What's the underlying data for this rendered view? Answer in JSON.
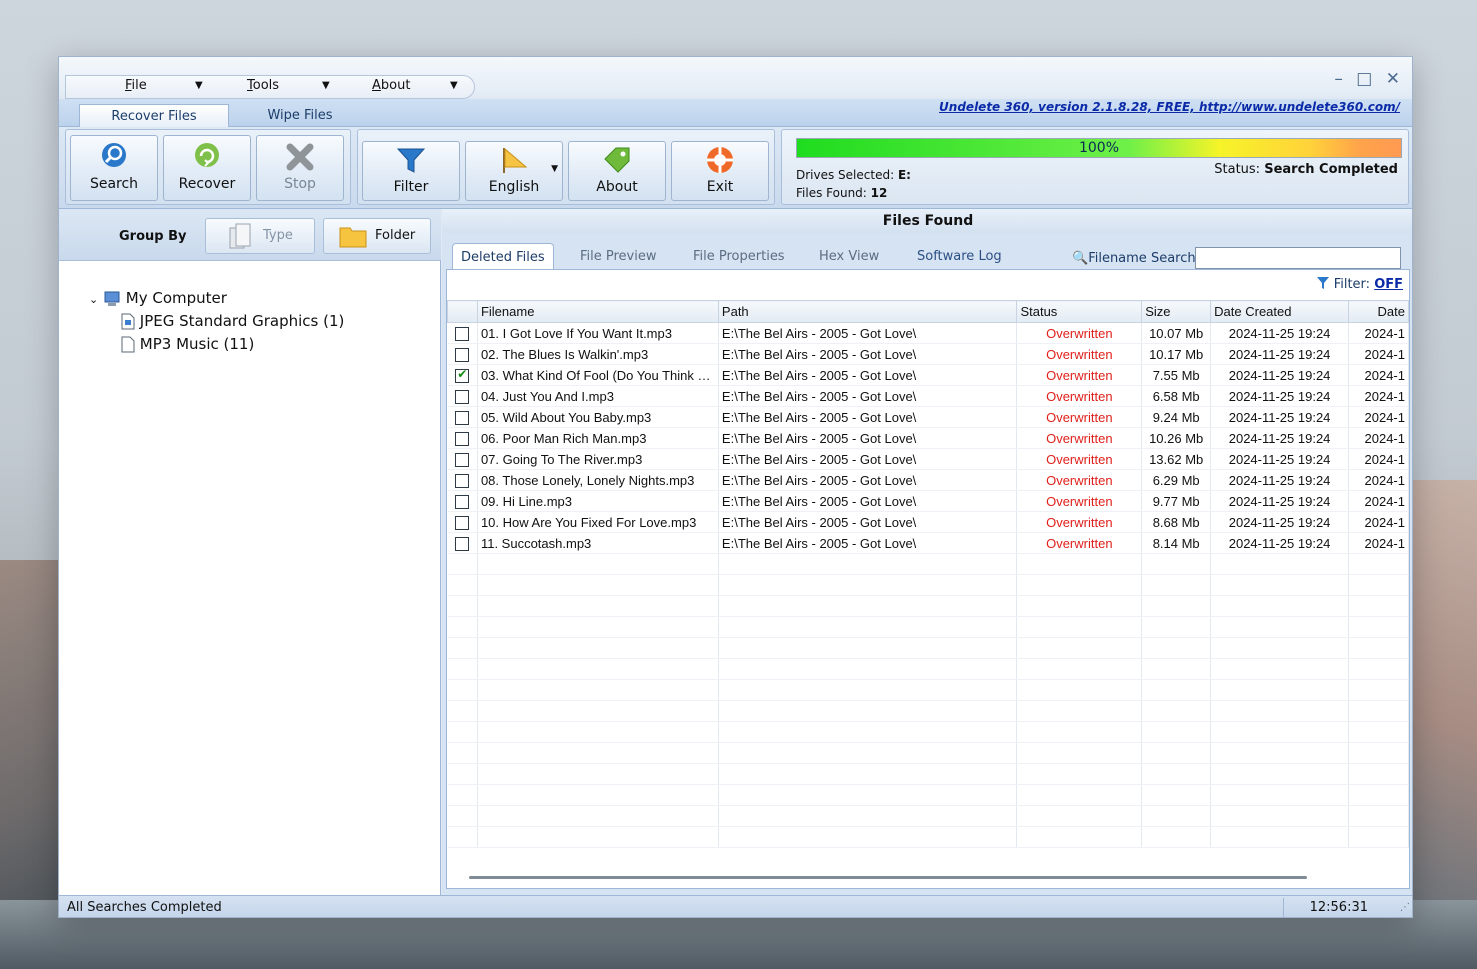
{
  "menu": {
    "file": "File",
    "tools": "Tools",
    "about": "About"
  },
  "window_controls": "– □ ✕",
  "tabs": {
    "recover_files": "Recover Files",
    "wipe_files": "Wipe Files"
  },
  "version_link": "Undelete 360, version 2.1.8.28, FREE, http://www.undelete360.com/",
  "ribbon": {
    "search": "Search",
    "recover": "Recover",
    "stop": "Stop",
    "filter": "Filter",
    "english": "English",
    "about": "About",
    "exit": "Exit"
  },
  "progress": {
    "value_text": "100%",
    "percent": 100,
    "drives_label": "Drives Selected:",
    "drives_value": "E:",
    "files_label": "Files Found:",
    "files_value": "12",
    "status_label": "Status:",
    "status_value": "Search Completed"
  },
  "left": {
    "group_by": "Group By",
    "type_btn": "Type",
    "folder_btn": "Folder",
    "tree": {
      "root": "My Computer",
      "children": [
        "JPEG Standard Graphics (1)",
        "MP3 Music (11)"
      ]
    }
  },
  "right": {
    "title": "Files Found",
    "subtabs": [
      "Deleted Files",
      "File Preview",
      "File Properties",
      "Hex View",
      "Software Log"
    ],
    "search_label": "Filename Search:",
    "search_value": "",
    "filter_label": "Filter:",
    "filter_value": "OFF"
  },
  "table": {
    "columns": [
      "Filename",
      "Path",
      "Status",
      "Size",
      "Date Created",
      "Date"
    ],
    "rows": [
      {
        "checked": false,
        "name": "01. I Got Love If You Want It.mp3",
        "path": "E:\\The Bel Airs - 2005 - Got Love\\",
        "status": "Overwritten",
        "size": "10.07 Mb",
        "created": "2024-11-25 19:24",
        "date": "2024-1"
      },
      {
        "checked": false,
        "name": "02. The Blues Is Walkin'.mp3",
        "path": "E:\\The Bel Airs - 2005 - Got Love\\",
        "status": "Overwritten",
        "size": "10.17 Mb",
        "created": "2024-11-25 19:24",
        "date": "2024-1"
      },
      {
        "checked": true,
        "name": "03. What Kind Of Fool (Do You Think …",
        "path": "E:\\The Bel Airs - 2005 - Got Love\\",
        "status": "Overwritten",
        "size": "7.55 Mb",
        "created": "2024-11-25 19:24",
        "date": "2024-1"
      },
      {
        "checked": false,
        "name": "04. Just You And I.mp3",
        "path": "E:\\The Bel Airs - 2005 - Got Love\\",
        "status": "Overwritten",
        "size": "6.58 Mb",
        "created": "2024-11-25 19:24",
        "date": "2024-1"
      },
      {
        "checked": false,
        "name": "05. Wild About You Baby.mp3",
        "path": "E:\\The Bel Airs - 2005 - Got Love\\",
        "status": "Overwritten",
        "size": "9.24 Mb",
        "created": "2024-11-25 19:24",
        "date": "2024-1"
      },
      {
        "checked": false,
        "name": "06. Poor Man Rich Man.mp3",
        "path": "E:\\The Bel Airs - 2005 - Got Love\\",
        "status": "Overwritten",
        "size": "10.26 Mb",
        "created": "2024-11-25 19:24",
        "date": "2024-1"
      },
      {
        "checked": false,
        "name": "07. Going To The River.mp3",
        "path": "E:\\The Bel Airs - 2005 - Got Love\\",
        "status": "Overwritten",
        "size": "13.62 Mb",
        "created": "2024-11-25 19:24",
        "date": "2024-1"
      },
      {
        "checked": false,
        "name": "08. Those Lonely, Lonely Nights.mp3",
        "path": "E:\\The Bel Airs - 2005 - Got Love\\",
        "status": "Overwritten",
        "size": "6.29 Mb",
        "created": "2024-11-25 19:24",
        "date": "2024-1"
      },
      {
        "checked": false,
        "name": "09. Hi Line.mp3",
        "path": "E:\\The Bel Airs - 2005 - Got Love\\",
        "status": "Overwritten",
        "size": "9.77 Mb",
        "created": "2024-11-25 19:24",
        "date": "2024-1"
      },
      {
        "checked": false,
        "name": "10. How Are You Fixed For Love.mp3",
        "path": "E:\\The Bel Airs - 2005 - Got Love\\",
        "status": "Overwritten",
        "size": "8.68 Mb",
        "created": "2024-11-25 19:24",
        "date": "2024-1"
      },
      {
        "checked": false,
        "name": "11. Succotash.mp3",
        "path": "E:\\The Bel Airs - 2005 - Got Love\\",
        "status": "Overwritten",
        "size": "8.14 Mb",
        "created": "2024-11-25 19:24",
        "date": "2024-1"
      }
    ]
  },
  "statusbar": {
    "left": "All Searches Completed",
    "time": "12:56:31"
  },
  "colors": {
    "status_overwritten": "#e0201b",
    "link": "#0b2aa8",
    "accent": "#1c3d6a"
  },
  "icons": {
    "search": "magnifier-icon",
    "recover": "recycle-icon",
    "stop": "x-icon",
    "filter": "funnel-icon",
    "english": "flag-icon",
    "about": "tag-icon",
    "exit": "lifebuoy-icon"
  }
}
